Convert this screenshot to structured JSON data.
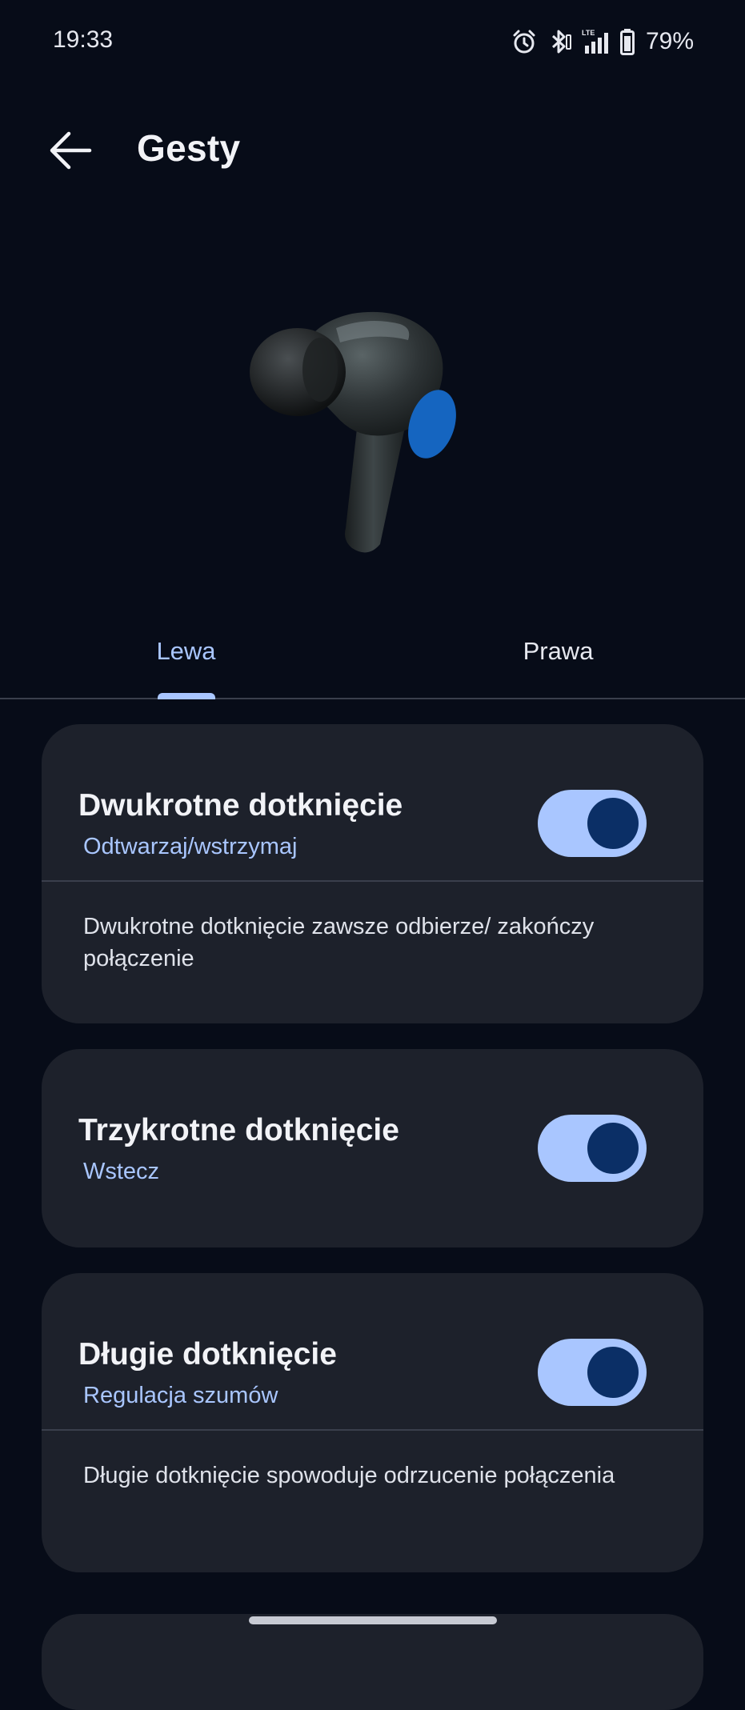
{
  "status_bar": {
    "time": "19:33",
    "battery": "79%",
    "icons": [
      "alarm-icon",
      "bluetooth-icon",
      "lte-signal-icon",
      "battery-icon"
    ]
  },
  "app_bar": {
    "title": "Gesty",
    "back_icon": "back-arrow-icon"
  },
  "tabs": [
    {
      "label": "Lewa",
      "selected": true
    },
    {
      "label": "Prawa",
      "selected": false
    }
  ],
  "gestures": [
    {
      "title": "Dwukrotne dotknięcie",
      "value": "Odtwarzaj/wstrzymaj",
      "enabled": true,
      "description": "Dwukrotne dotknięcie zawsze odbierze/ zakończy połączenie"
    },
    {
      "title": "Trzykrotne dotknięcie",
      "value": "Wstecz",
      "enabled": true
    },
    {
      "title": "Długie dotknięcie",
      "value": "Regulacja szumów",
      "enabled": true,
      "description": "Długie dotknięcie spowoduje odrzucenie połączenia"
    }
  ],
  "colors": {
    "background": "#070c18",
    "card": "#1d212b",
    "accent": "#a9c6ff",
    "toggle_thumb": "#0b2f66",
    "touch_area": "#1565c0"
  }
}
